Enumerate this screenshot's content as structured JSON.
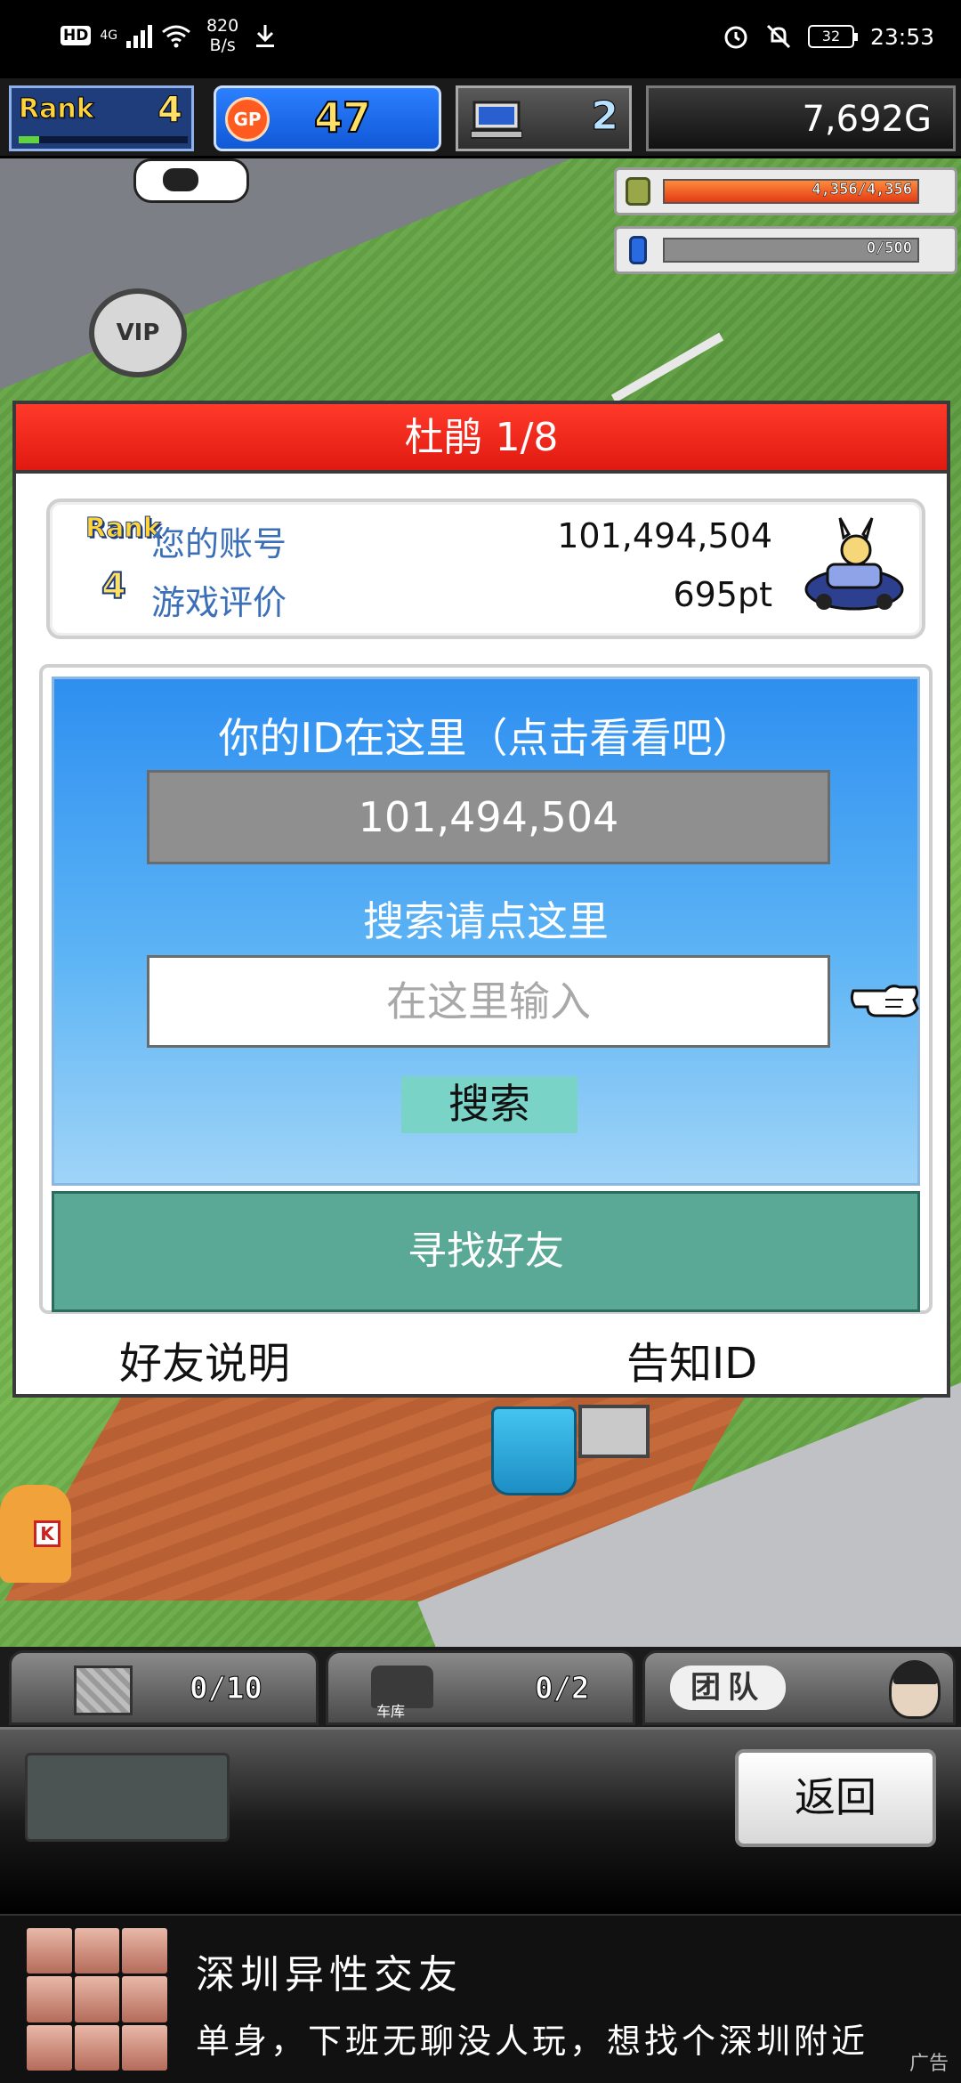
{
  "status_bar": {
    "hd": "HD",
    "network": "4G",
    "speed_value": "820",
    "speed_unit": "B/s",
    "battery": "32",
    "time": "23:53",
    "icons": [
      "wifi-icon",
      "download-icon",
      "alarm-icon",
      "mute-icon",
      "battery-icon"
    ]
  },
  "hud": {
    "rank_label": "Rank",
    "rank_value": "4",
    "gp_label": "GP",
    "gp_value": "47",
    "pc_value": "2",
    "gold_value": "7,692G"
  },
  "meters": {
    "fuel_text": "4,356/4,356",
    "fuel_fraction": 1.0,
    "energy_text": "0/500",
    "energy_fraction": 0.0
  },
  "scene": {
    "vip_label": "VIP",
    "mascot_letter": "K"
  },
  "dialog": {
    "title": "杜鹃 1/8",
    "rank_label": "Rank",
    "rank_value": "4",
    "account_label": "您的账号",
    "account_value": "101,494,504",
    "rating_label": "游戏评价",
    "rating_value": "695pt",
    "id_hint": "你的ID在这里（点击看看吧）",
    "id_value": "101,494,504",
    "search_hint": "搜索请点这里",
    "search_placeholder": "在这里输入",
    "search_button": "搜索",
    "find_friends_button": "寻找好友",
    "friend_help_link": "好友说明",
    "share_id_link": "告知ID"
  },
  "bottom_tabs": {
    "items_count": "0/10",
    "garage_count": "0/2",
    "garage_label": "车库",
    "team_label": "团队"
  },
  "action_bar": {
    "back_button": "返回"
  },
  "ad": {
    "title": "深圳异性交友",
    "text": "单身，下班无聊没人玩，想找个深圳附近",
    "badge": "广告"
  }
}
